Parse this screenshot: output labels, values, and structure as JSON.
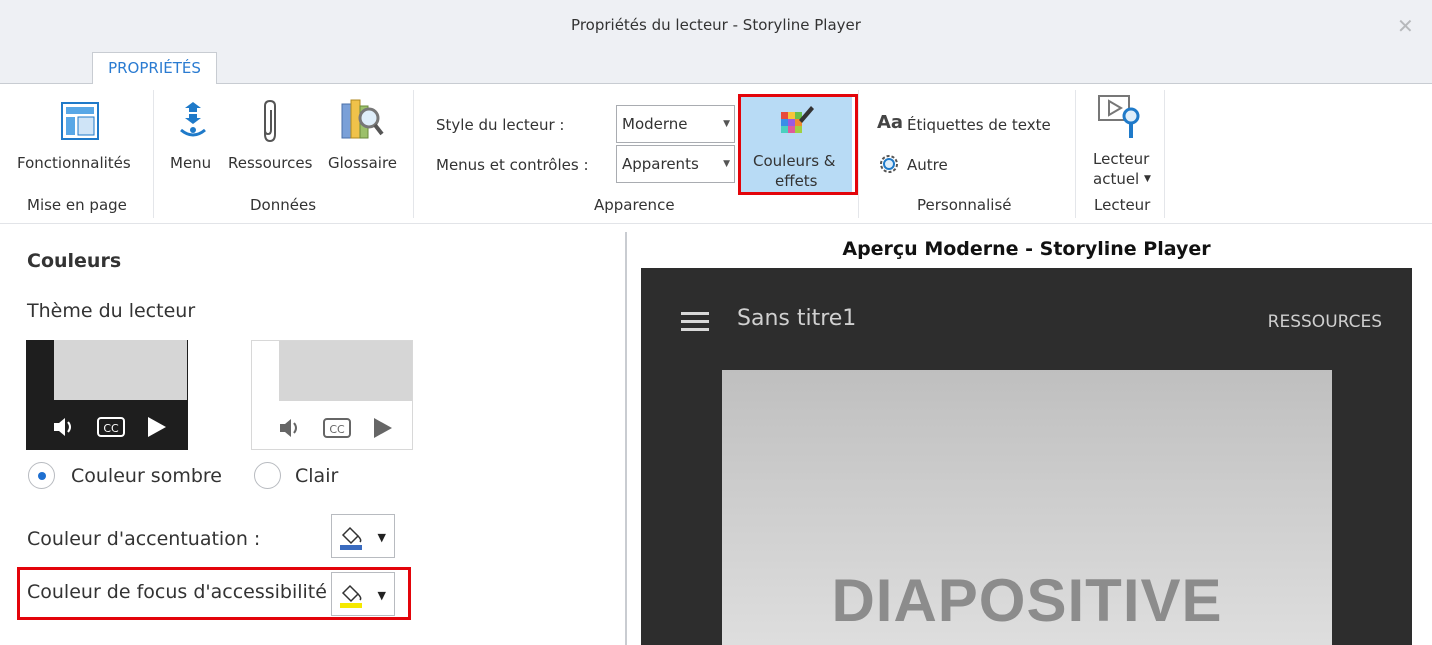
{
  "window": {
    "title": "Propriétés du lecteur - Storyline Player",
    "close_glyph": "✕"
  },
  "tabs": [
    {
      "label": "PROPRIÉTÉS",
      "active": true
    }
  ],
  "ribbon": {
    "layout_group": {
      "label": "Mise en page",
      "features_button": "Fonctionnalités"
    },
    "data_group": {
      "label": "Données",
      "menu_button": "Menu",
      "resources_button": "Ressources",
      "glossary_button": "Glossaire"
    },
    "appearance_group": {
      "label": "Apparence",
      "player_style_label": "Style du lecteur :",
      "player_style_value": "Moderne",
      "menus_controls_label": "Menus et contrôles :",
      "menus_controls_value": "Apparents",
      "colors_effects_line1": "Couleurs &",
      "colors_effects_line2": "effets"
    },
    "custom_group": {
      "label": "Personnalisé",
      "text_labels_prefix": "Aa",
      "text_labels_button": "Étiquettes de texte",
      "other_button": "Autre"
    },
    "player_group": {
      "label": "Lecteur",
      "current_player_line1": "Lecteur",
      "current_player_line2": "actuel"
    }
  },
  "colors_panel": {
    "heading": "Couleurs",
    "theme_label": "Thème du lecteur",
    "themes": [
      {
        "label": "Couleur sombre",
        "selected": true
      },
      {
        "label": "Clair",
        "selected": false
      }
    ],
    "accent_color_label": "Couleur d'accentuation :",
    "accent_color": "#3a6bbf",
    "focus_color_label": "Couleur de focus d'accessibilité :",
    "focus_color": "#f5e900"
  },
  "preview": {
    "title": "Aperçu Moderne - Storyline Player",
    "course_title": "Sans titre1",
    "resources_label": "RESSOURCES",
    "slide_text": "DIAPOSITIVE"
  },
  "colors": {
    "accent_blue": "#2a7bd1",
    "highlight": "#e3040a",
    "selected_button": "#b8dbf5",
    "player_bg": "#2d2d2d"
  }
}
